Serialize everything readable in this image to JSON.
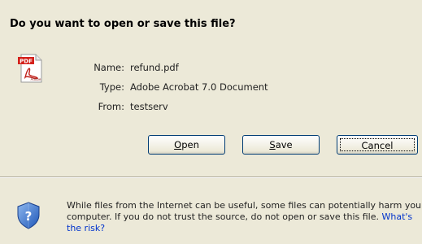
{
  "dialog": {
    "question": "Do you want to open or save this file?"
  },
  "file": {
    "icon": "pdf-file-icon",
    "icon_badge": "PDF",
    "icon_brand": "Adobe",
    "name_label": "Name:",
    "name_value": "refund.pdf",
    "type_label": "Type:",
    "type_value": "Adobe Acrobat 7.0 Document",
    "from_label": "From:",
    "from_value": "testserv"
  },
  "buttons": {
    "open_mnemonic": "O",
    "open_rest": "pen",
    "save_mnemonic": "S",
    "save_rest": "ave",
    "cancel_label": "Cancel"
  },
  "warning": {
    "icon": "shield-question-icon",
    "text": "While files from the Internet can be useful, some files can potentially harm your computer. If you do not trust the source, do not open or save this file.",
    "link_text": "What's the risk?"
  },
  "colors": {
    "background": "#ece9d8",
    "button_border": "#003c74",
    "link": "#0033cc",
    "pdf_badge": "#d4211b"
  }
}
